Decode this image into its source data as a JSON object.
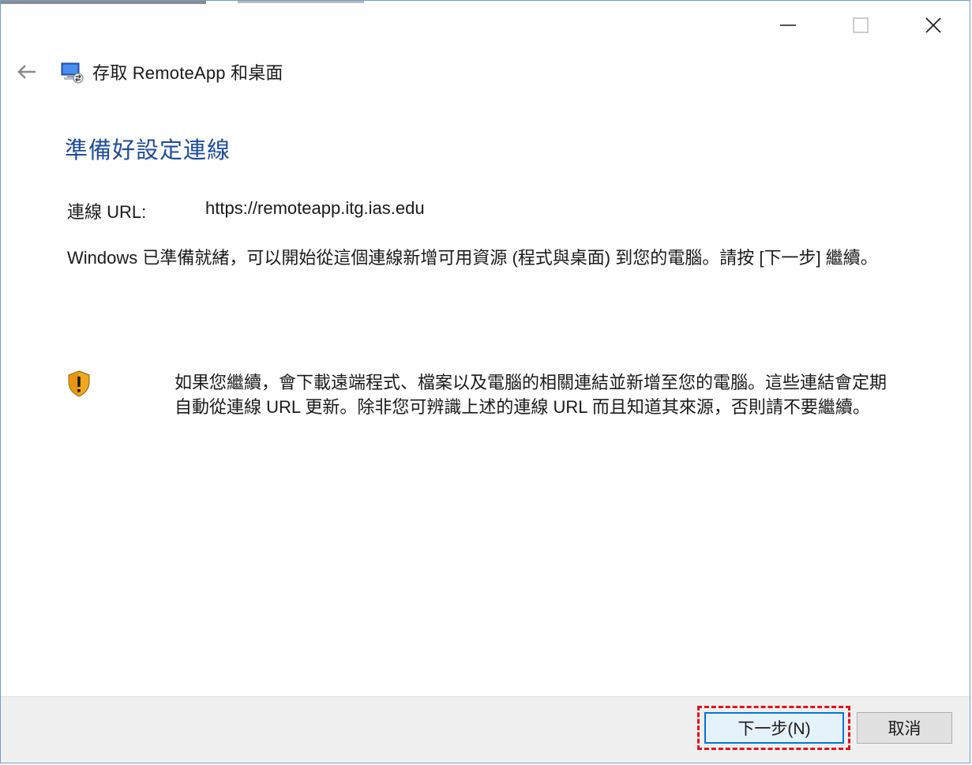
{
  "window": {
    "title": "存取 RemoteApp 和桌面",
    "controls": {
      "minimize_icon": "minimize-icon",
      "maximize_icon": "maximize-icon",
      "close_icon": "close-icon"
    },
    "back_icon": "back-arrow-icon",
    "app_icon": "remoteapp-icon"
  },
  "main": {
    "heading": "準備好設定連線",
    "url_label": "連線 URL:",
    "url_value": "https://remoteapp.itg.ias.edu",
    "description": "Windows 已準備就緒，可以開始從這個連線新增可用資源 (程式與桌面) 到您的電腦。請按 [下一步] 繼續。",
    "warning_icon": "shield-warning-icon",
    "warning_text": "如果您繼續，會下載遠端程式、檔案以及電腦的相關連結並新增至您的電腦。這些連結會定期自動從連線 URL 更新。除非您可辨識上述的連線 URL 而且知道其來源，否則請不要繼續。"
  },
  "footer": {
    "next_label": "下一步(N)",
    "cancel_label": "取消"
  },
  "colors": {
    "heading": "#1e4c9c",
    "highlight": "#e0141e",
    "button_focus": "#0078d7",
    "footer_bg": "#f0f0f0"
  }
}
